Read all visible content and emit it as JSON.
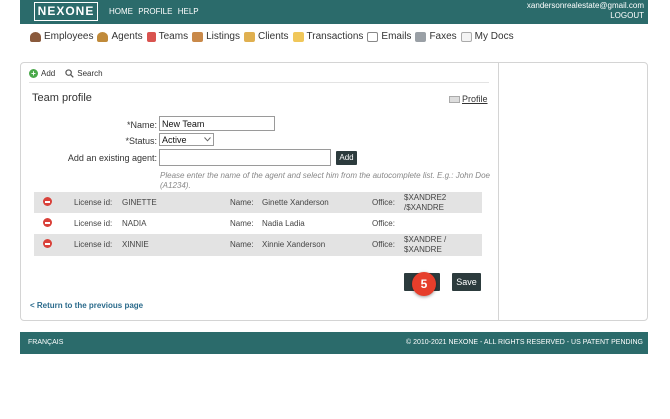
{
  "topbar": {
    "logo": "NEXONE",
    "nav": [
      "HOME",
      "PROFILE",
      "HELP"
    ],
    "email": "xandersonrealestate@gmail.com",
    "logout": "LOGOUT",
    "color": "#2b6b6b"
  },
  "mainnav": [
    {
      "label": "Employees",
      "icon": "employees-icon"
    },
    {
      "label": "Agents",
      "icon": "agents-icon"
    },
    {
      "label": "Teams",
      "icon": "teams-icon"
    },
    {
      "label": "Listings",
      "icon": "listings-icon"
    },
    {
      "label": "Clients",
      "icon": "clients-icon"
    },
    {
      "label": "Transactions",
      "icon": "folder-icon"
    },
    {
      "label": "Emails",
      "icon": "email-icon"
    },
    {
      "label": "Faxes",
      "icon": "fax-icon"
    },
    {
      "label": "My Docs",
      "icon": "docs-icon"
    }
  ],
  "toolbar": {
    "add": "Add",
    "search": "Search"
  },
  "page": {
    "title": "Team profile",
    "profile_link": "Profile"
  },
  "form": {
    "name_label": "*Name:",
    "name_value": "New Team",
    "status_label": "*Status:",
    "status_value": "Active",
    "agent_label": "Add an existing agent:",
    "agent_value": "",
    "add_button": "Add",
    "hint": "Please enter the name of the agent and select him from the autocomplete list. E.g.: John Doe (A1234)."
  },
  "agents": {
    "license_label": "License id:",
    "name_label": "Name:",
    "office_label": "Office:",
    "rows": [
      {
        "license": "GINETTE",
        "name": "Ginette Xanderson",
        "office": "$XANDRE2 /$XANDRE"
      },
      {
        "license": "NADIA",
        "name": "Nadia Ladia",
        "office": ""
      },
      {
        "license": "XINNIE",
        "name": "Xinnie Xanderson",
        "office": "$XANDRE / $XANDRE"
      }
    ]
  },
  "actions": {
    "save": "Save",
    "step_badge": "5",
    "back": "< Return to the previous page"
  },
  "footer": {
    "language": "FRANÇAIS",
    "copyright": "© 2010-2021 NEXONE - ALL RIGHTS RESERVED - US PATENT PENDING"
  }
}
